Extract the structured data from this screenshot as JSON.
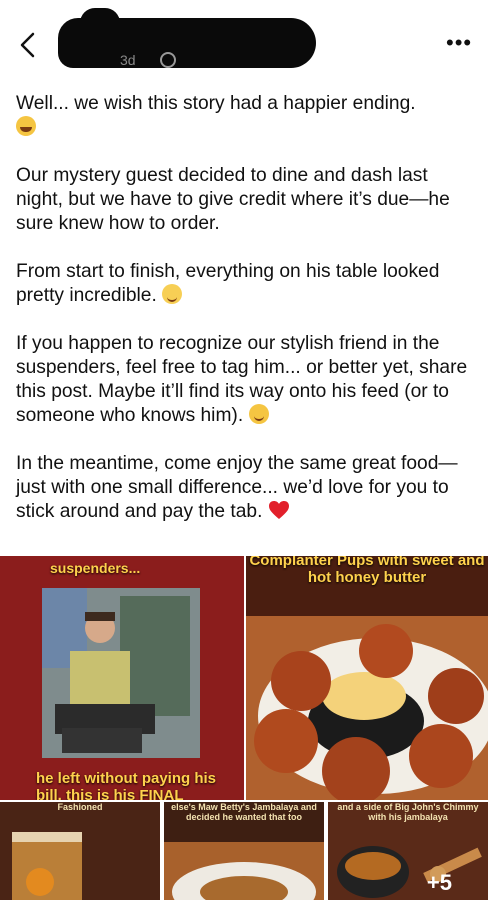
{
  "header": {
    "meta": "3d",
    "more_icon": "•••"
  },
  "post": {
    "p1": "Well... we wish this story had a happier ending.",
    "p2": "Our mystery guest decided to dine and dash last night, but we have to give credit where it’s due—he sure knew how to order.",
    "p3": "From start to finish, everything on his table looked pretty incredible.",
    "p4": "If you happen to recognize our stylish friend in the suspenders, feel free to tag him... or better yet, share this post. Maybe it’ll find its way onto his feed (or to someone who knows him).",
    "p5": "In the meantime, come enjoy the same great food—just with one small difference... we’d love for you to stick around and pay the tab."
  },
  "gallery": {
    "tile1_top": "suspenders...",
    "tile1_bottom": "he left without paying his bill. this is his FINAL",
    "tile2_top": "Complanter Pups with sweet and hot honey butter",
    "tile3_top": "Fashioned",
    "tile4_top": "else's Maw Betty's Jambalaya and decided he wanted that too",
    "tile5_top": "and a side of Big John's Chimmy with his jambalaya",
    "more_count": "+5"
  }
}
